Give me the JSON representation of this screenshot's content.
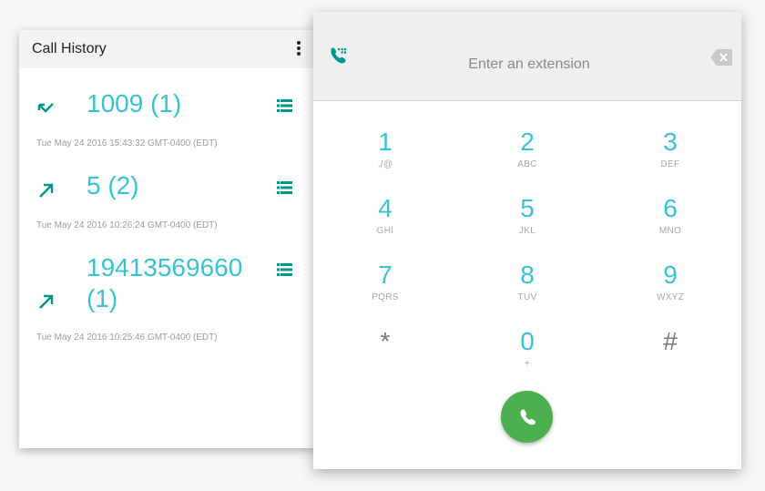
{
  "colors": {
    "accent": "#37c3d3",
    "icon_teal": "#009688",
    "call_green": "#4caf50"
  },
  "history": {
    "title": "Call History",
    "menu_icon": "more-vert-icon",
    "entries": [
      {
        "direction_icon": "call-missed-icon",
        "number": "1009 (1)",
        "date": "Tue May 24 2016 15:43:32 GMT-0400 (EDT)",
        "details_icon": "list-icon"
      },
      {
        "direction_icon": "call-made-icon",
        "number": "5 (2)",
        "date": "Tue May 24 2016 10:26:24 GMT-0400 (EDT)",
        "details_icon": "list-icon"
      },
      {
        "direction_icon": "call-made-icon",
        "number": "19413569660 (1)",
        "date": "Tue May 24 2016 10:25:46 GMT-0400 (EDT)",
        "details_icon": "list-icon"
      }
    ]
  },
  "dialer": {
    "dialpad_icon": "dialpad-phone-icon",
    "input": {
      "placeholder": "Enter an extension",
      "value": ""
    },
    "backspace_icon": "backspace-icon",
    "keys": [
      {
        "digit": "1",
        "letters": "./@"
      },
      {
        "digit": "2",
        "letters": "ABC"
      },
      {
        "digit": "3",
        "letters": "DEF"
      },
      {
        "digit": "4",
        "letters": "GHI"
      },
      {
        "digit": "5",
        "letters": "JKL"
      },
      {
        "digit": "6",
        "letters": "MNO"
      },
      {
        "digit": "7",
        "letters": "PQRS"
      },
      {
        "digit": "8",
        "letters": "TUV"
      },
      {
        "digit": "9",
        "letters": "WXYZ"
      },
      {
        "digit": "*",
        "letters": ""
      },
      {
        "digit": "0",
        "letters": "+"
      },
      {
        "digit": "#",
        "letters": ""
      }
    ],
    "call_icon": "phone-icon"
  }
}
